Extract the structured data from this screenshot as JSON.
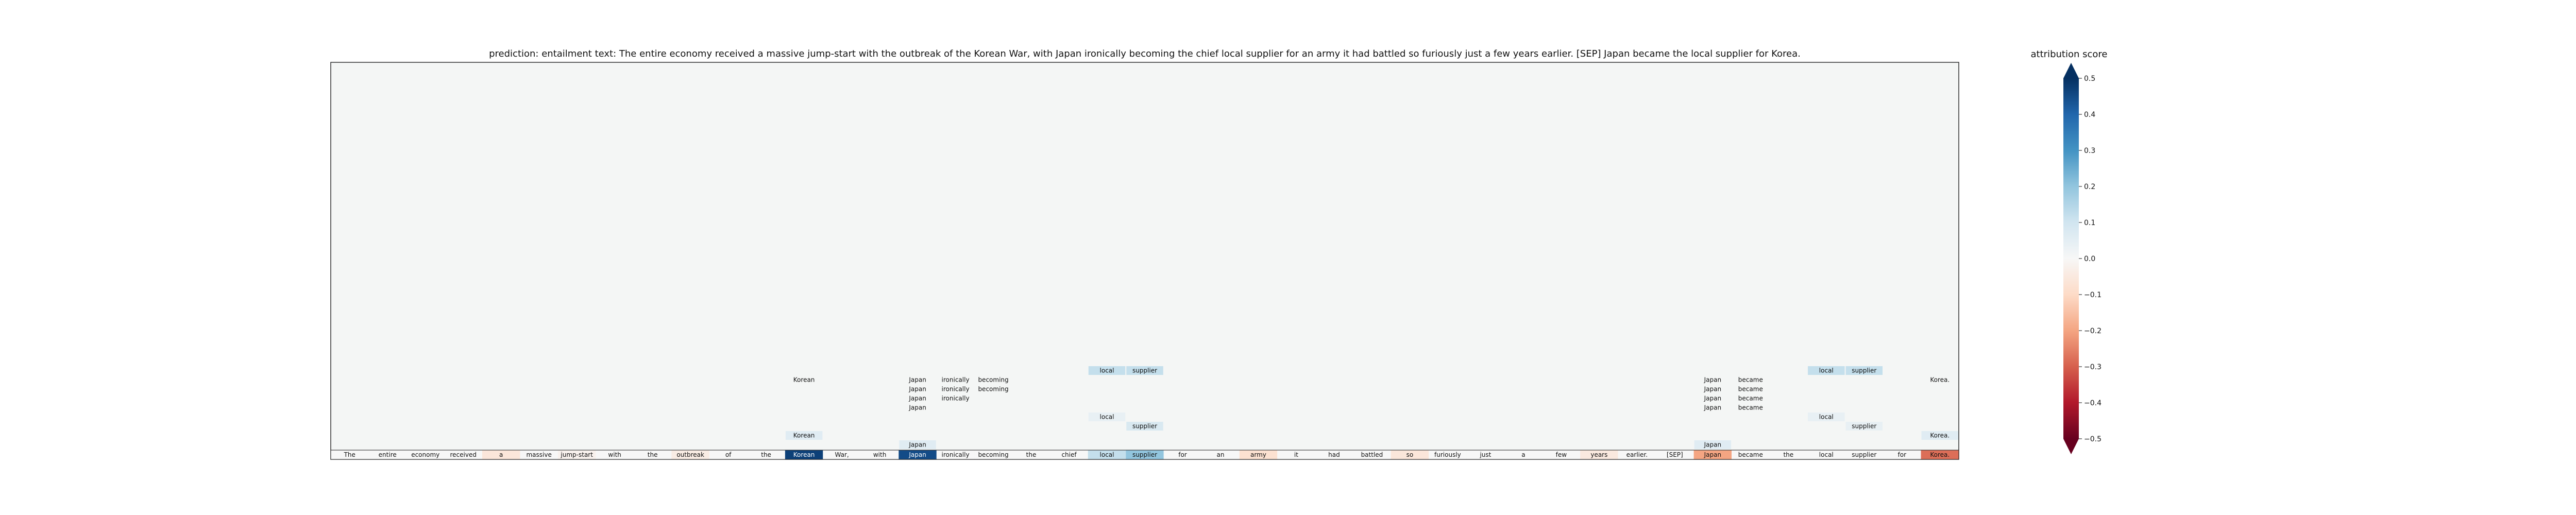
{
  "chart_data": {
    "type": "heatmap",
    "title": "prediction:  entailment     text:  The entire economy received a massive jump-start with the outbreak of the Korean War, with Japan ironically becoming the chief local supplier for an army it had battled so furiously just a few years earlier. [SEP] Japan became the local supplier for Korea.",
    "colorbar": {
      "label": "attribution score",
      "ticks": [
        0.5,
        0.4,
        0.3,
        0.2,
        0.1,
        0.0,
        -0.1,
        -0.2,
        -0.3,
        -0.4,
        -0.5
      ],
      "tick_labels": [
        "0.5",
        "0.4",
        "0.3",
        "0.2",
        "0.1",
        "0.0",
        "−0.1",
        "−0.2",
        "−0.3",
        "−0.4",
        "−0.5"
      ],
      "range": [
        -0.5,
        0.5
      ],
      "colormap": "RdBu"
    },
    "tokens": [
      "The",
      "entire",
      "economy",
      "received",
      "a",
      "massive",
      "jump-start",
      "with",
      "the",
      "outbreak",
      "of",
      "the",
      "Korean",
      "War,",
      "with",
      "Japan",
      "ironically",
      "becoming",
      "the",
      "chief",
      "local",
      "supplier",
      "for",
      "an",
      "army",
      "it",
      "had",
      "battled",
      "so",
      "furiously",
      "just",
      "a",
      "few",
      "years",
      "earlier.",
      "[SEP]",
      "Japan",
      "became",
      "the",
      "local",
      "supplier",
      "for",
      "Korea."
    ],
    "scores": [
      0.0,
      0.0,
      0.0,
      0.0,
      -0.06,
      0.0,
      -0.02,
      0.0,
      0.0,
      -0.04,
      0.0,
      0.0,
      0.47,
      0.0,
      0.0,
      0.45,
      0.0,
      0.0,
      0.0,
      0.0,
      0.12,
      0.2,
      0.0,
      0.0,
      -0.08,
      0.0,
      0.0,
      0.0,
      -0.06,
      0.0,
      0.0,
      0.0,
      0.0,
      -0.05,
      0.0,
      0.0,
      -0.2,
      0.0,
      0.0,
      0.0,
      0.0,
      0.0,
      -0.28
    ],
    "attention_cells": [
      {
        "row": 0,
        "col": 20,
        "text": "local",
        "value": 0.12
      },
      {
        "row": 0,
        "col": 21,
        "text": "supplier",
        "value": 0.12
      },
      {
        "row": 0,
        "col": 39,
        "text": "local",
        "value": 0.12
      },
      {
        "row": 0,
        "col": 40,
        "text": "supplier",
        "value": 0.12
      },
      {
        "row": 1,
        "col": 12,
        "text": "Korean",
        "value": 0.0
      },
      {
        "row": 1,
        "col": 15,
        "text": "Japan",
        "value": 0.0
      },
      {
        "row": 1,
        "col": 16,
        "text": "ironically",
        "value": 0.0
      },
      {
        "row": 1,
        "col": 17,
        "text": "becoming",
        "value": 0.0
      },
      {
        "row": 1,
        "col": 36,
        "text": "Japan",
        "value": 0.0
      },
      {
        "row": 1,
        "col": 37,
        "text": "became",
        "value": 0.0
      },
      {
        "row": 1,
        "col": 42,
        "text": "Korea.",
        "value": 0.0
      },
      {
        "row": 2,
        "col": 15,
        "text": "Japan",
        "value": 0.0
      },
      {
        "row": 2,
        "col": 16,
        "text": "ironically",
        "value": 0.0
      },
      {
        "row": 2,
        "col": 17,
        "text": "becoming",
        "value": 0.0
      },
      {
        "row": 2,
        "col": 36,
        "text": "Japan",
        "value": 0.0
      },
      {
        "row": 2,
        "col": 37,
        "text": "became",
        "value": 0.0
      },
      {
        "row": 3,
        "col": 15,
        "text": "Japan",
        "value": 0.0
      },
      {
        "row": 3,
        "col": 16,
        "text": "ironically",
        "value": 0.0
      },
      {
        "row": 3,
        "col": 36,
        "text": "Japan",
        "value": 0.0
      },
      {
        "row": 3,
        "col": 37,
        "text": "became",
        "value": 0.0
      },
      {
        "row": 4,
        "col": 15,
        "text": "Japan",
        "value": 0.0
      },
      {
        "row": 4,
        "col": 36,
        "text": "Japan",
        "value": 0.0
      },
      {
        "row": 4,
        "col": 37,
        "text": "became",
        "value": 0.0
      },
      {
        "row": 5,
        "col": 20,
        "text": "local",
        "value": 0.04
      },
      {
        "row": 5,
        "col": 39,
        "text": "local",
        "value": 0.04
      },
      {
        "row": 6,
        "col": 21,
        "text": "supplier",
        "value": 0.08
      },
      {
        "row": 6,
        "col": 40,
        "text": "supplier",
        "value": 0.04
      },
      {
        "row": 7,
        "col": 12,
        "text": "Korean",
        "value": 0.06
      },
      {
        "row": 7,
        "col": 42,
        "text": "Korea.",
        "value": 0.06
      },
      {
        "row": 8,
        "col": 15,
        "text": "Japan",
        "value": 0.06
      },
      {
        "row": 8,
        "col": 36,
        "text": "Japan",
        "value": 0.06
      }
    ],
    "grid": false
  }
}
